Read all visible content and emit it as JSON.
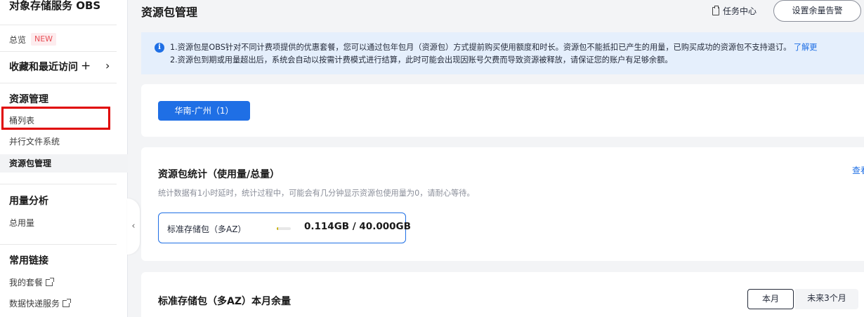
{
  "sidebar": {
    "title": "对象存储服务 OBS",
    "overview": {
      "label": "总览",
      "badge": "NEW"
    },
    "favorites": {
      "label": "收藏和最近访问",
      "plus": "+",
      "chevron": "›"
    },
    "sections": [
      {
        "heading": "资源管理",
        "items": [
          "桶列表",
          "并行文件系统",
          "资源包管理"
        ]
      },
      {
        "heading": "用量分析",
        "items": [
          "总用量"
        ]
      },
      {
        "heading": "常用链接",
        "items": [
          "我的套餐",
          "数据快递服务"
        ]
      }
    ],
    "collapse_glyph": "‹"
  },
  "header": {
    "title": "资源包管理",
    "task_center": "任务中心",
    "alarm_button": "设置余量告警"
  },
  "notice": {
    "line1": "1.资源包是OBS针对不同计费项提供的优惠套餐，您可以通过包年包月（资源包）方式提前购买使用额度和时长。资源包不能抵扣已产生的用量，已购买成功的资源包不支持退订。",
    "learn_more": "了解更",
    "line2": "2.资源包到期或用量超出后，系统会自动以按需计费模式进行结算，此时可能会出现因账号欠费而导致资源被释放，请保证您的账户有足够余额。"
  },
  "region": {
    "label": "华南-广州（1）"
  },
  "stats": {
    "title": "资源包统计（使用量/总量）",
    "subtitle": "统计数据有1小时延时，统计过程中，可能会有几分钟显示资源包使用量为0，请耐心等待。",
    "view_link": "查看",
    "package": {
      "name": "标准存储包（多AZ）",
      "value": "0.114GB / 40.000GB",
      "used_fraction": 0.00285
    }
  },
  "remaining": {
    "title": "标准存储包（多AZ）本月余量",
    "tabs": [
      "本月",
      "未来3个月"
    ]
  },
  "colors": {
    "primary": "#1f6fe5",
    "badge": "#e84e55",
    "highlight": "#e00000"
  }
}
